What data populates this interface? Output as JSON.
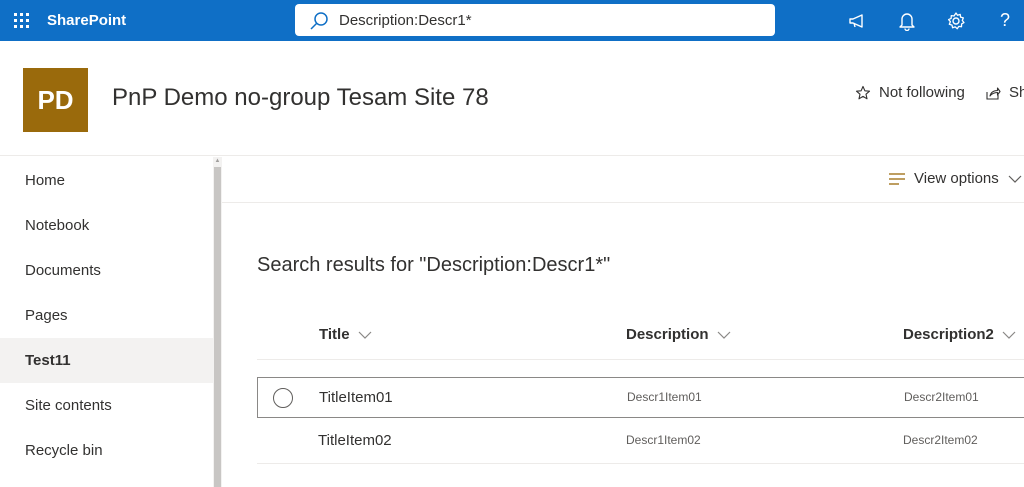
{
  "suitebar": {
    "brand": "SharePoint",
    "search_value": "Description:Descr1*",
    "colors": {
      "bar": "#0f6fc6"
    },
    "icons": [
      "app-launcher-icon",
      "search-icon",
      "megaphone-icon",
      "bell-icon",
      "gear-icon",
      "help-icon"
    ]
  },
  "site": {
    "logo_initials": "PD",
    "logo_color": "#9a6a0c",
    "title": "PnP Demo no-group Tesam Site 78",
    "follow_label": "Not following",
    "share_label": "Share"
  },
  "nav": {
    "items": [
      {
        "label": "Home",
        "selected": false
      },
      {
        "label": "Notebook",
        "selected": false
      },
      {
        "label": "Documents",
        "selected": false
      },
      {
        "label": "Pages",
        "selected": false
      },
      {
        "label": "Test11",
        "selected": true
      },
      {
        "label": "Site contents",
        "selected": false
      },
      {
        "label": "Recycle bin",
        "selected": false
      }
    ]
  },
  "commandbar": {
    "view_options_label": "View options"
  },
  "results": {
    "heading": "Search results for \"Description:Descr1*\"",
    "columns": [
      "Title",
      "Description",
      "Description2"
    ],
    "rows": [
      {
        "title": "TitleItem01",
        "description": "Descr1Item01",
        "description2": "Descr2Item01"
      },
      {
        "title": "TitleItem02",
        "description": "Descr1Item02",
        "description2": "Descr2Item02"
      }
    ]
  }
}
